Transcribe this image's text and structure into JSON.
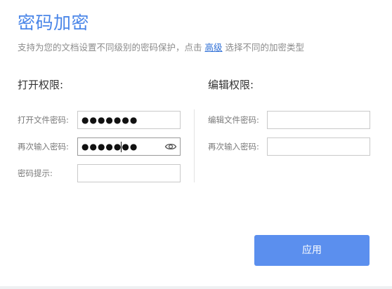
{
  "dialog": {
    "title": "密码加密",
    "description_before": "支持为您的文档设置不同级别的密码保护，点击",
    "description_link": "高级",
    "description_after": "选择不同的加密类型"
  },
  "open_section": {
    "title": "打开权限:",
    "fields": [
      {
        "label": "打开文件密码:",
        "value": "●●●●●●●"
      },
      {
        "label": "再次输入密码:",
        "value": "●●●●●●●"
      },
      {
        "label": "密码提示:",
        "value": ""
      }
    ],
    "show_password_icon": "eye-icon"
  },
  "edit_section": {
    "title": "编辑权限:",
    "fields": [
      {
        "label": "编辑文件密码:",
        "value": ""
      },
      {
        "label": "再次输入密码:",
        "value": ""
      }
    ]
  },
  "actions": {
    "apply_label": "应用"
  },
  "colors": {
    "accent": "#4a86e8",
    "button": "#5b8fee",
    "link": "#2f6fd6"
  }
}
